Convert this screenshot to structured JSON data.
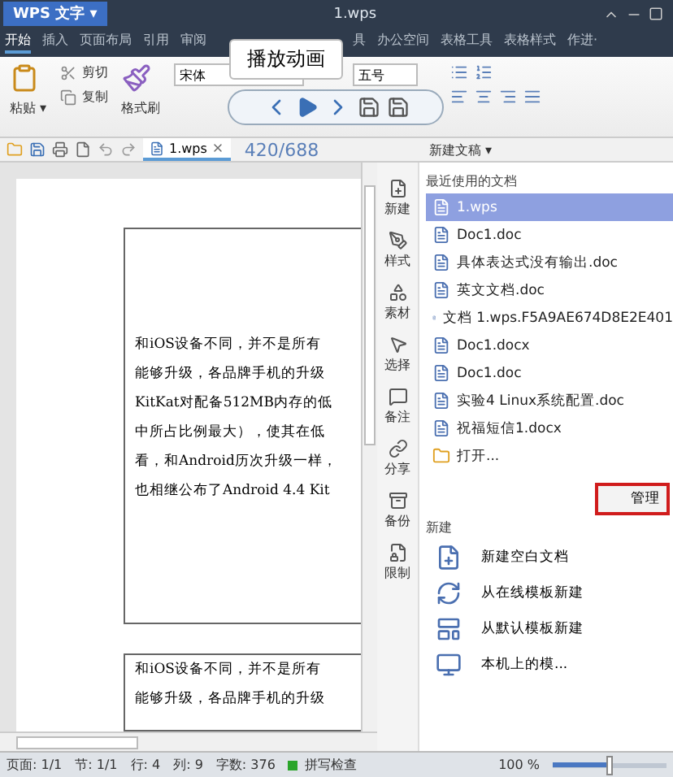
{
  "title_bar": {
    "app_button": "WPS 文字 ▾",
    "document_title": "1.wps"
  },
  "menu": [
    {
      "label": "开始",
      "selected": true
    },
    {
      "label": "插入",
      "selected": false
    },
    {
      "label": "页面布局",
      "selected": false
    },
    {
      "label": "引用",
      "selected": false
    },
    {
      "label": "审阅",
      "selected": false
    },
    {
      "label": "具",
      "selected": false
    },
    {
      "label": "办公空间",
      "selected": false
    },
    {
      "label": "表格工具",
      "selected": false
    },
    {
      "label": "表格样式",
      "selected": false
    },
    {
      "label": "作进·",
      "selected": false
    }
  ],
  "ribbon": {
    "paste": "粘贴 ▾",
    "cut": "剪切",
    "copy": "复制",
    "format_painter": "格式刷",
    "font_name": "宋体",
    "font_size": "五号"
  },
  "playback_popup": {
    "tooltip": "播放动画"
  },
  "document_tabs": [
    {
      "label": "1.wps",
      "selected": true
    }
  ],
  "time_overlay": "420/688",
  "document": {
    "text_box_1": [
      "和iOS设备不同，并不是所有",
      "能够升级，各品牌手机的升级",
      "KitKat对配备512MB内存的低",
      "中所占比例最大），使其在低",
      "看，和Android历次升级一样，",
      "也相继公布了Android 4.4 Kit"
    ],
    "text_box_2": [
      "和iOS设备不同，并不是所有",
      "能够升级，各品牌手机的升级"
    ]
  },
  "task_pane": {
    "title": "新建文稿 ▾",
    "tools": [
      "新建",
      "样式",
      "素材",
      "选择",
      "备注",
      "分享",
      "备份",
      "限制"
    ],
    "recent_heading": "最近使用的文档",
    "recent": [
      {
        "name": "1.wps",
        "selected": true
      },
      {
        "name": "Doc1.doc",
        "selected": false
      },
      {
        "name": "具体表达式没有输出.doc",
        "selected": false
      },
      {
        "name": "英文文档.doc",
        "selected": false
      },
      {
        "name": "文档 1.wps.F5A9AE674D8E2E401",
        "selected": false
      },
      {
        "name": "Doc1.docx",
        "selected": false
      },
      {
        "name": "Doc1.doc",
        "selected": false
      },
      {
        "name": "实验4 Linux系统配置.doc",
        "selected": false
      },
      {
        "name": "祝福短信1.docx",
        "selected": false
      }
    ],
    "open": "打开...",
    "manage_button": "管理",
    "new_heading": "新建",
    "new_items": [
      "新建空白文档",
      "从在线模板新建",
      "从默认模板新建",
      "本机上的模..."
    ]
  },
  "status_bar": {
    "fields": [
      "页面: 1/1",
      "节: 1/1",
      "行: 4",
      "列: 9",
      "字数: 376"
    ],
    "spell_check": "拼写检查",
    "zoom": "100 %",
    "zoom_slider": {
      "level": 0.5
    }
  }
}
